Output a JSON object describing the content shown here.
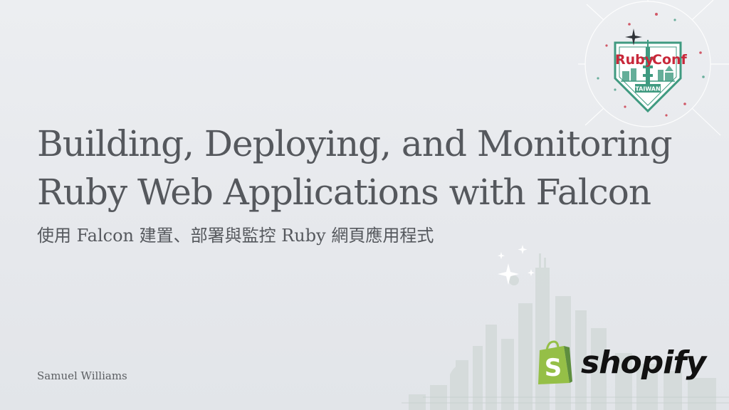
{
  "slide": {
    "title_lines": [
      "Building, Deploying, and Monitoring",
      "Ruby Web Applications with Falcon"
    ],
    "subtitle": "使用 Falcon 建置、部署與監控 Ruby 網頁應用程式",
    "author": "Samuel Williams"
  },
  "conference_logo": {
    "word_left": "Ruby",
    "word_right": "Conf",
    "region": "TAIWAN",
    "colors": {
      "red": "#c8283a",
      "green": "#3f9a80"
    }
  },
  "sponsor": {
    "name": "shopify",
    "bag_icon_letter": "S",
    "colors": {
      "bag_green": "#95bf47",
      "bag_dark": "#5e8e3e",
      "text": "#111111"
    }
  },
  "colors": {
    "background": "#e8eaee",
    "text": "#55585d",
    "skyline": "#c9d2d0"
  },
  "icons": [
    "sparkle-icon",
    "skyline-illustration",
    "rubyconf-taiwan-logo",
    "shopify-bag-icon"
  ]
}
